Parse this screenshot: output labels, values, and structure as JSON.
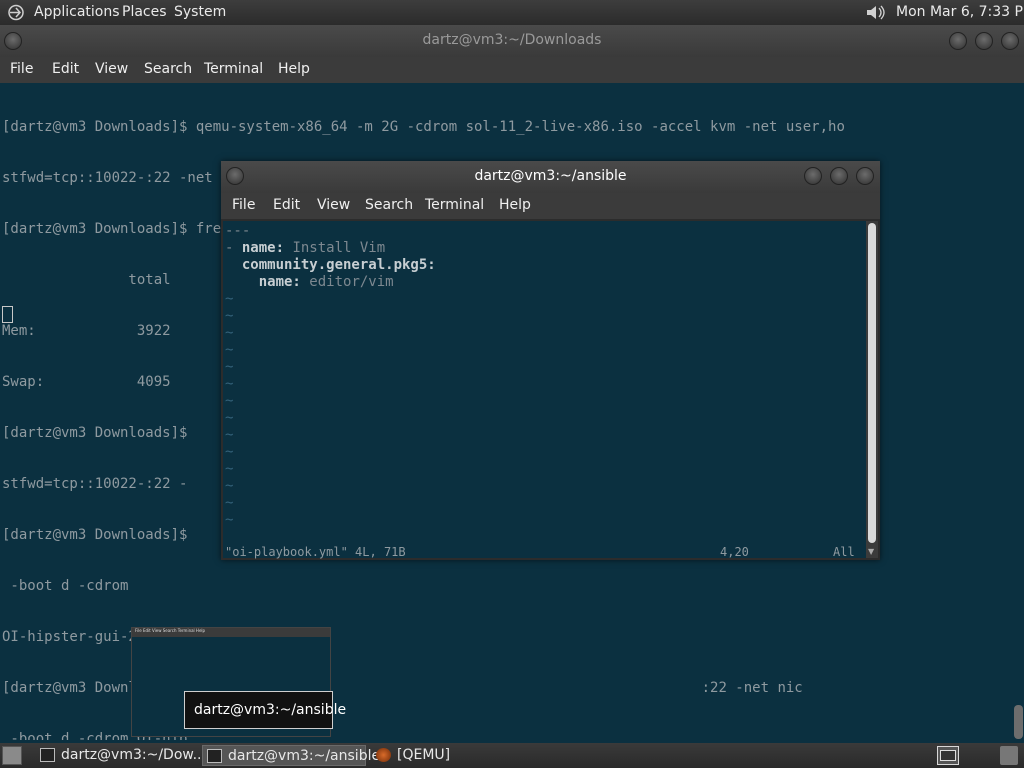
{
  "top_panel": {
    "applications": "Applications",
    "places": "Places",
    "system": "System",
    "clock": "Mon Mar  6,  7:33 PM"
  },
  "win_downloads": {
    "title": "dartz@vm3:~/Downloads",
    "menu": [
      "File",
      "Edit",
      "View",
      "Search",
      "Terminal",
      "Help"
    ],
    "lines": [
      "[dartz@vm3 Downloads]$ qemu-system-x86_64 -m 2G -cdrom sol-11_2-live-x86.iso -accel kvm -net user,ho",
      "stfwd=tcp::10022-:22 -net nic -boot d",
      "[dartz@vm3 Downloads]$ free -m",
      "               total        used        free      shared  buff/cache   available",
      "Mem:            3922         369        1117          17        2444        3257",
      "Swap:           4095",
      "[dartz@vm3 Downloads]$                                                            -net user,ho",
      "stfwd=tcp::10022-:22 -",
      "[dartz@vm3 Downloads]$                                                             :22 -net nic",
      " -boot d -cdrom",
      "OI-hipster-gui-2022112",
      "[dartz@vm3 Downloads]$                                                             :22 -net nic",
      " -boot d -cdrom OI-hip"
    ]
  },
  "win_ansible": {
    "title": "dartz@vm3:~/ansible",
    "menu": [
      "File",
      "Edit",
      "View",
      "Search",
      "Terminal",
      "Help"
    ],
    "yaml": {
      "doc_start": "---",
      "dash": "- ",
      "k_name": "name:",
      "v_name": " Install Vim",
      "k_module": "community.general.pkg5:",
      "k_pkg": "name:",
      "v_pkg": " editor/vim"
    },
    "tilde": "~",
    "status": {
      "file": "\"oi-playbook.yml\" 4L, 71B",
      "pos": "4,20",
      "scroll": "All"
    }
  },
  "preview": {
    "menu": "File  Edit  View  Search  Terminal  Help"
  },
  "tooltip": "dartz@vm3:~/ansible",
  "taskbar": {
    "items": [
      "dartz@vm3:~/Dow...",
      "dartz@vm3:~/ansible",
      "[QEMU]"
    ]
  }
}
